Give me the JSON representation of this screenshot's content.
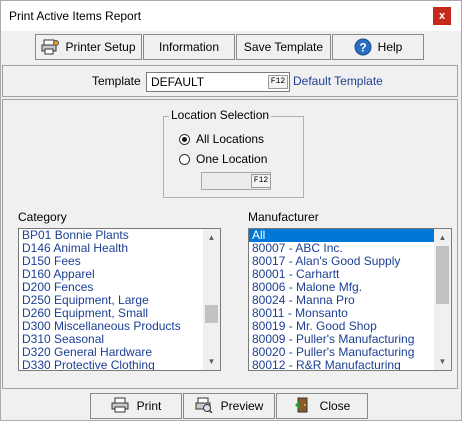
{
  "window": {
    "title": "Print Active Items Report",
    "close_glyph": "x"
  },
  "toolbar": {
    "printer_setup": "Printer Setup",
    "information": "Information",
    "save_template": "Save Template",
    "help": "Help"
  },
  "template": {
    "label": "Template",
    "value": "DEFAULT",
    "lookup_key": "F12",
    "description": "Default Template"
  },
  "location": {
    "legend": "Location Selection",
    "all_label": "All Locations",
    "one_label": "One Location",
    "selected": "All Locations",
    "lookup_key": "F12"
  },
  "category": {
    "label": "Category",
    "items": [
      "BP01 Bonnie Plants",
      "D146 Animal Health",
      "D150 Fees",
      "D160 Apparel",
      "D200 Fences",
      "D250 Equipment, Large",
      "D260 Equipment, Small",
      "D300 Miscellaneous Products",
      "D310 Seasonal",
      "D320 General Hardware",
      "D330 Protective Clothing"
    ]
  },
  "manufacturer": {
    "label": "Manufacturer",
    "selected_index": 0,
    "items": [
      "All",
      "80007 - ABC Inc.",
      "80017 - Alan's Good Supply",
      "80001 - Carhartt",
      "80006 - Malone Mfg.",
      "80024 - Manna Pro",
      "80011 - Monsanto",
      "80019 - Mr. Good Shop",
      "80009 - Puller's Manufacturing",
      "80020 - Puller's Manufacturing",
      "80012 - R&R Manufacturing"
    ]
  },
  "bottom": {
    "print": "Print",
    "preview": "Preview",
    "close": "Close"
  },
  "colors": {
    "link_text": "#1c3f95",
    "selection": "#0078d7",
    "close_button": "#c42b1c"
  },
  "icons": [
    "printer-setup-icon",
    "help-icon",
    "print-icon",
    "preview-icon",
    "close-door-icon"
  ]
}
